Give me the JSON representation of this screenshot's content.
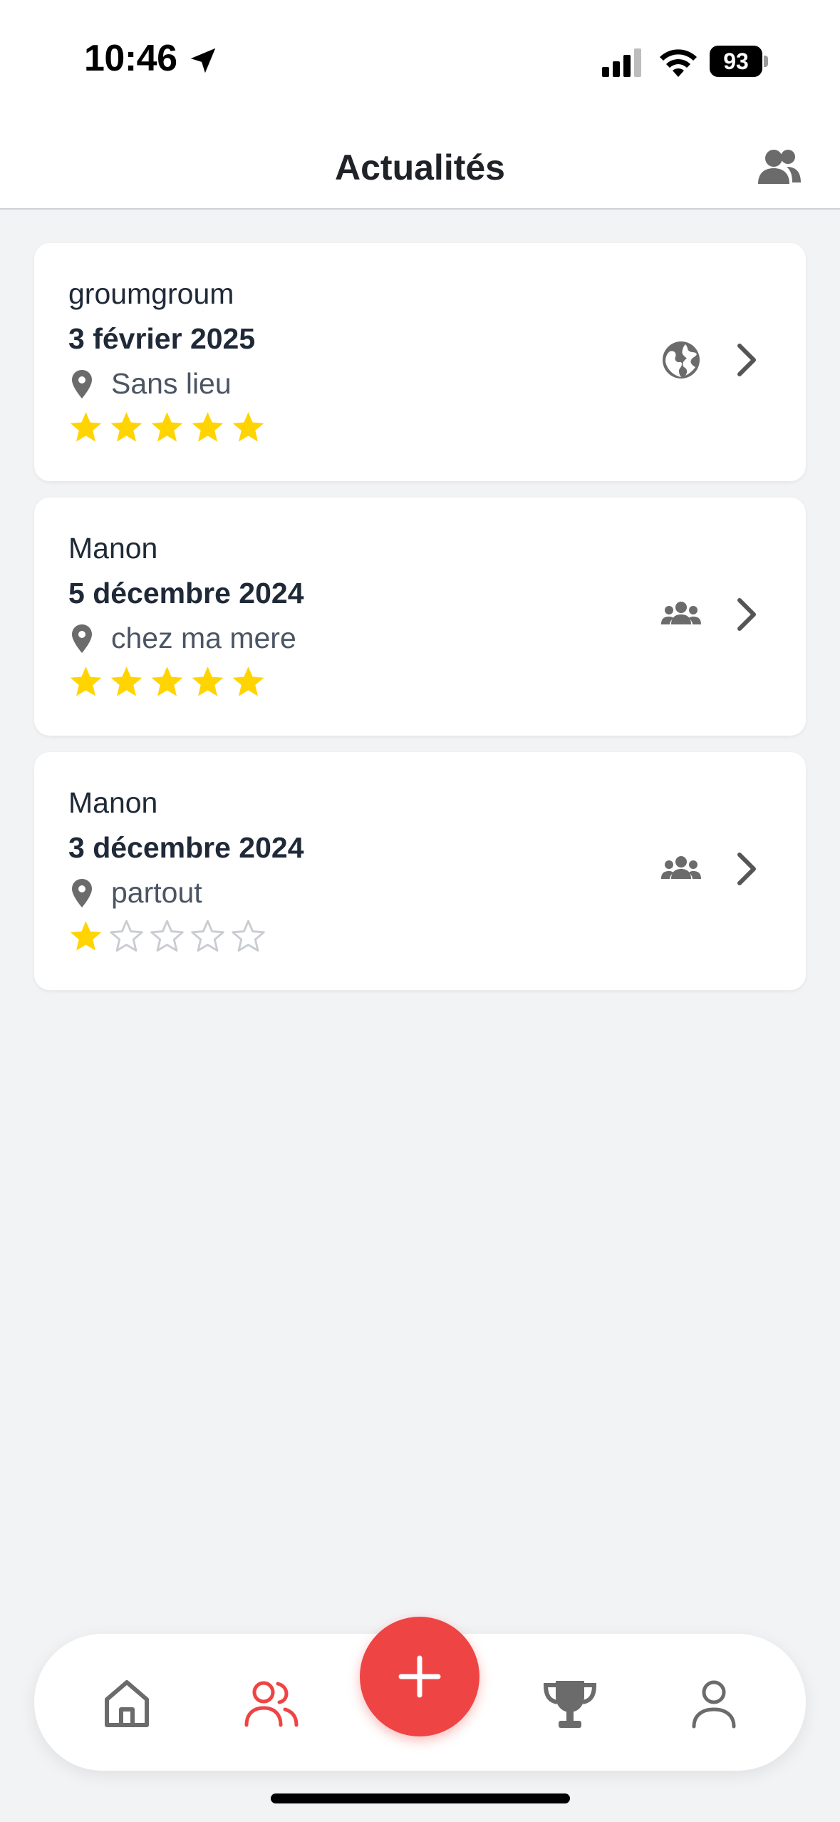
{
  "status_bar": {
    "time": "10:46",
    "battery": "93"
  },
  "header": {
    "title": "Actualités",
    "right_icon": "users-icon"
  },
  "feed": [
    {
      "name": "groumgroum",
      "date": "3 février 2025",
      "location": "Sans lieu",
      "rating": 5,
      "max_rating": 5,
      "visibility": "public-globe-icon"
    },
    {
      "name": "Manon",
      "date": "5 décembre 2024",
      "location": "chez ma mere",
      "rating": 5,
      "max_rating": 5,
      "visibility": "friends-group-icon"
    },
    {
      "name": "Manon",
      "date": "3 décembre 2024",
      "location": "partout",
      "rating": 1,
      "max_rating": 5,
      "visibility": "friends-group-icon"
    }
  ],
  "tab_bar": {
    "items": [
      "home-icon",
      "friends-icon",
      "add-icon",
      "trophy-icon",
      "profile-icon"
    ],
    "active": "friends-icon"
  },
  "colors": {
    "accent": "#ef4444",
    "star": "#ffd400",
    "star_empty": "#c9ccd1",
    "icon": "#6b6b6b"
  }
}
